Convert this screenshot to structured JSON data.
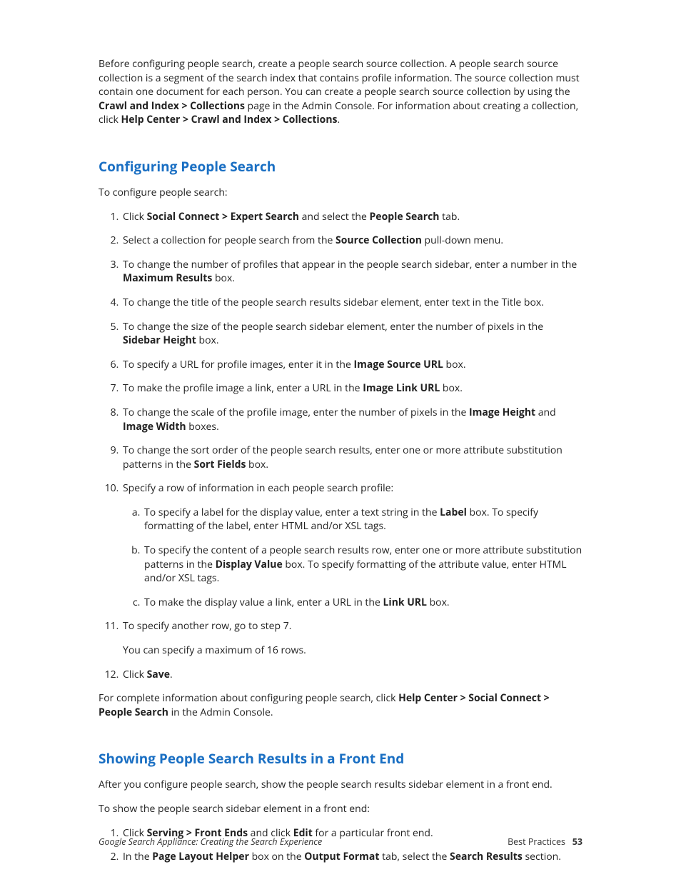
{
  "intro": {
    "part1": "Before configuring people search, create a people search source collection. A people search source collection is a segment of the search index that contains profile information. The source collection must contain one document for each person. You can create a people search source collection by using the ",
    "bold1": "Crawl and Index > Collections",
    "part2": " page in the Admin Console. For information about creating a collection, click ",
    "bold2": "Help Center > Crawl and Index > Collections",
    "part3": "."
  },
  "section1": {
    "heading": "Configuring People Search",
    "lead": "To configure people search:",
    "steps": {
      "s1": {
        "a": "Click ",
        "b1": "Social Connect > Expert Search",
        "c": " and select the ",
        "b2": "People Search",
        "d": " tab."
      },
      "s2": {
        "a": "Select a collection for people search from the ",
        "b1": "Source Collection",
        "c": " pull-down menu."
      },
      "s3": {
        "a": "To change the number of profiles that appear in the people search sidebar, enter a number in the ",
        "b1": "Maximum Results",
        "c": " box."
      },
      "s4": {
        "a": "To change the title of the people search results sidebar element, enter text in the Title box."
      },
      "s5": {
        "a": "To change the size of the people search sidebar element, enter the number of pixels in the ",
        "b1": "Sidebar Height",
        "c": " box."
      },
      "s6": {
        "a": "To specify a URL for profile images, enter it in the ",
        "b1": "Image Source URL",
        "c": " box."
      },
      "s7": {
        "a": "To make the profile image a link, enter a URL in the ",
        "b1": "Image Link URL",
        "c": " box."
      },
      "s8": {
        "a": "To change the scale of the profile image, enter the number of pixels in the ",
        "b1": "Image Height",
        "c": " and ",
        "b2": "Image Width",
        "d": " boxes."
      },
      "s9": {
        "a": "To change the sort order of the people search results, enter one or more attribute substitution patterns in the ",
        "b1": "Sort Fields",
        "c": " box."
      },
      "s10": {
        "a": "Specify a row of information in each people search profile:",
        "sub": {
          "a": {
            "t1": "To specify a label for the display value, enter a text string in the ",
            "b1": "Label",
            "t2": " box. To specify formatting of the label, enter HTML and/or XSL tags."
          },
          "b": {
            "t1": "To specify the content of a people search results row, enter one or more attribute substitution patterns in the ",
            "b1": "Display Value",
            "t2": " box. To specify formatting of the attribute value, enter HTML and/or XSL tags."
          },
          "c": {
            "t1": "To make the display value a link, enter a URL in the ",
            "b1": "Link URL",
            "t2": " box."
          }
        }
      },
      "s11": {
        "a": "To specify another row, go to step 7.",
        "sub": "You can specify a maximum of 16 rows."
      },
      "s12": {
        "a": "Click ",
        "b1": "Save",
        "c": "."
      }
    },
    "outro": {
      "a": "For complete information about configuring people search, click ",
      "b1": "Help Center > Social Connect > People Search",
      "c": " in the Admin Console."
    }
  },
  "section2": {
    "heading": "Showing People Search Results in a Front End",
    "lead1": "After you configure people search, show the people search results sidebar element in a front end.",
    "lead2": "To show the people search sidebar element in a front end:",
    "steps": {
      "s1": {
        "a": "Click ",
        "b1": "Serving > Front Ends",
        "c": " and click ",
        "b2": "Edit",
        "d": " for a particular front end."
      },
      "s2": {
        "a": "In the ",
        "b1": "Page Layout Helper",
        "c": " box on the ",
        "b2": "Output Format",
        "d": " tab, select the ",
        "b3": "Search Results",
        "e": " section."
      }
    }
  },
  "footer": {
    "left": "Google Search Appliance: Creating the Search Experience",
    "right_label": "Best Practices",
    "page": "53"
  }
}
